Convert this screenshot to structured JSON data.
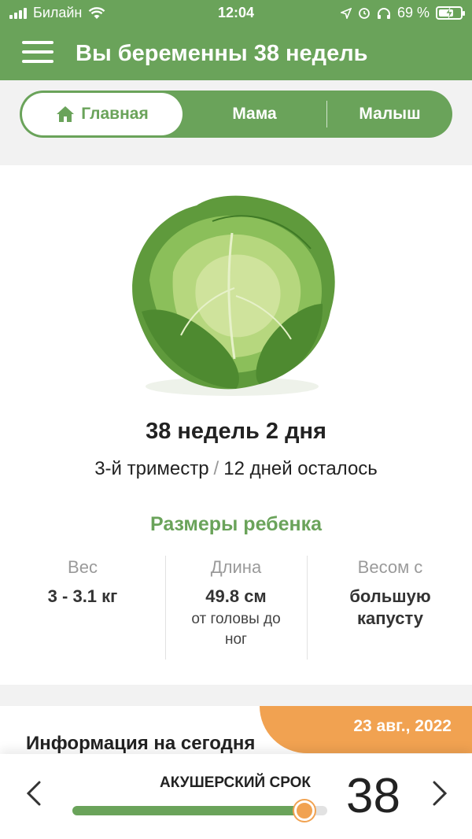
{
  "status_bar": {
    "carrier": "Билайн",
    "time": "12:04",
    "battery": "69 %",
    "battery_level": 0.69
  },
  "app_bar": {
    "title": "Вы беременны 38 недель"
  },
  "tabs": [
    {
      "label": "Главная",
      "icon": "home-icon",
      "active": true
    },
    {
      "label": "Мама",
      "active": false
    },
    {
      "label": "Малыш",
      "active": false
    }
  ],
  "summary": {
    "image": "cabbage",
    "weeks_text": "38 недель 2 дня",
    "trimester": "3-й триместр",
    "separator": "/",
    "remaining": "12 дней осталось"
  },
  "sizes": {
    "title": "Размеры ребенка",
    "weight": {
      "label": "Вес",
      "value": "3 - 3.1 кг"
    },
    "length": {
      "label": "Длина",
      "value": "49.8 см",
      "note": "от головы до ног"
    },
    "compare": {
      "label": "Весом с",
      "value": "большую капусту"
    }
  },
  "info": {
    "date": "23 авг., 2022",
    "heading": "Информация на сегодня"
  },
  "footer": {
    "term_label": "АКУШЕРСКИЙ СРОК",
    "week": "38",
    "progress": 0.91
  },
  "colors": {
    "primary": "#6aa35a",
    "accent": "#f1a251"
  }
}
